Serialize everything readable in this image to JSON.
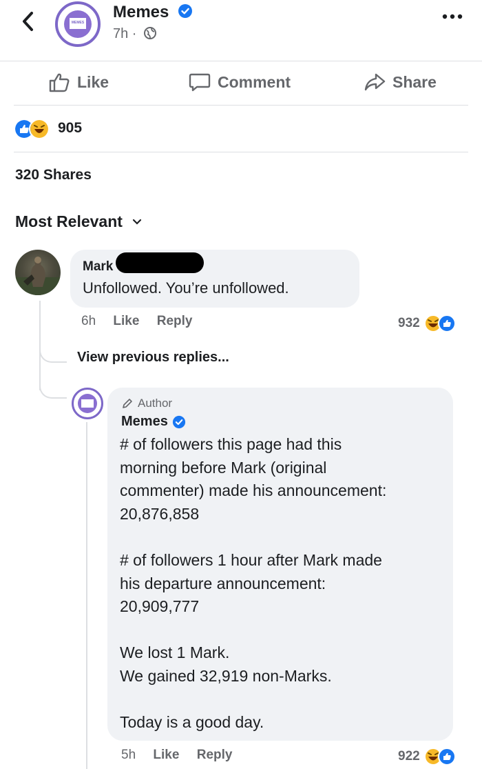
{
  "post": {
    "page_name": "Memes",
    "avatar_text": "MEMES",
    "time": "7h ·",
    "actions": {
      "like": "Like",
      "comment": "Comment",
      "share": "Share"
    },
    "reaction_count": "905",
    "shares": "320 Shares",
    "sort_label": "Most Relevant"
  },
  "comment": {
    "author": "Mark",
    "text": "Unfollowed.  You’re unfollowed.",
    "time": "6h",
    "like": "Like",
    "reply": "Reply",
    "reaction_count": "932"
  },
  "view_previous": "View previous replies...",
  "reply": {
    "badge": "Author",
    "author": "Memes",
    "lines": [
      "# of followers this page had this",
      "morning before Mark (original",
      "commenter) made his announcement:",
      "20,876,858",
      "",
      "# of followers 1 hour after Mark made",
      "his departure announcement:",
      "20,909,777",
      "",
      "We lost 1 Mark.",
      "We gained 32,919 non-Marks.",
      "",
      "Today is a good day."
    ],
    "time": "5h",
    "like": "Like",
    "reply": "Reply",
    "reaction_count": "922"
  },
  "colors": {
    "accent_blue": "#1877f2",
    "brand_purple": "#7d68c8",
    "haha_yellow": "#f7b928",
    "muted": "#65676b",
    "bubble": "#f0f2f5"
  }
}
